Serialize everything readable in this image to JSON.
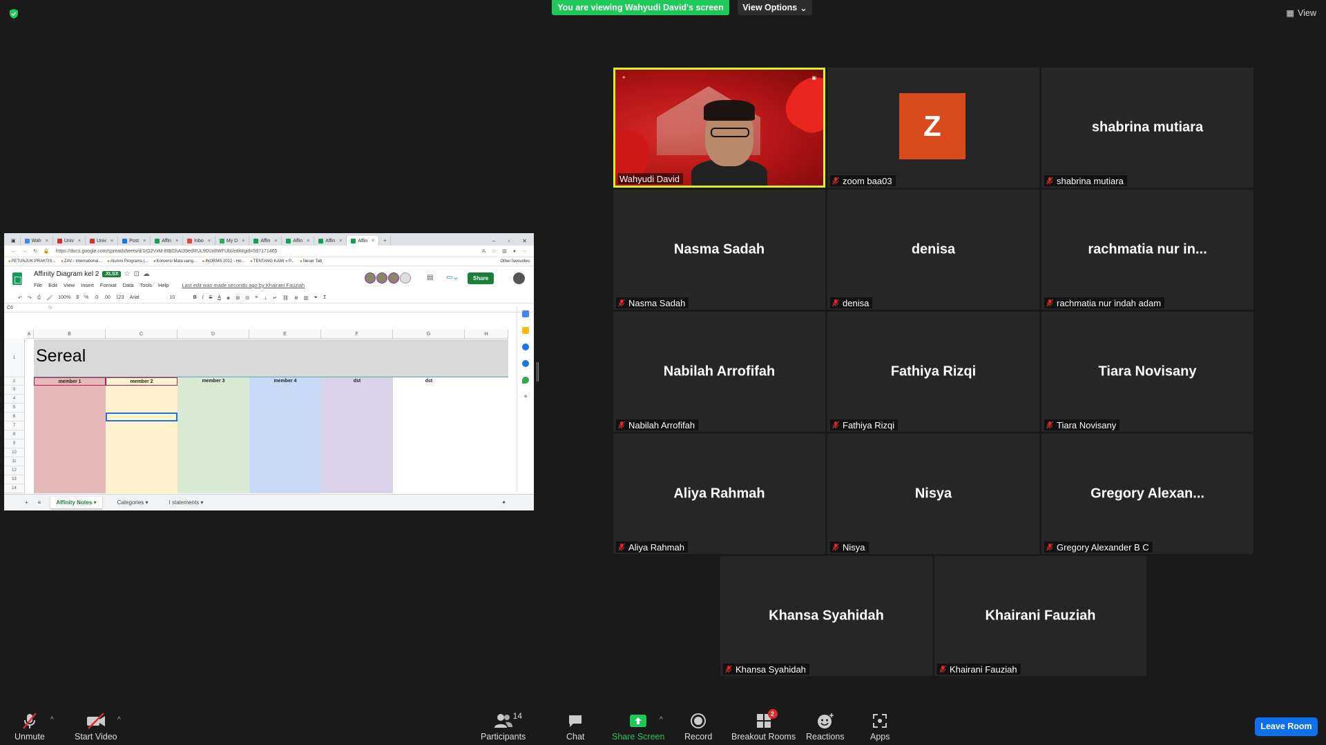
{
  "meeting": {
    "banner": "You are viewing Wahyudi David's screen",
    "view_options": "View Options",
    "view": "View"
  },
  "shared_screen": {
    "browser_tabs": [
      "Wah",
      "Univ",
      "Univ",
      "Post",
      "Affin",
      "Inbo",
      "My D",
      "Affin",
      "Affin",
      "Affin",
      "Affin"
    ],
    "url": "https://docs.google.com/spreadsheets/d/1IO2VxM-8IBGhAI39edRUL90Ux8WFUbI/edit#gid=597171465",
    "bookmarks": [
      "PETUNJUK PRAKTIS...",
      "ZAV - International...",
      "Alumni Programs |...",
      "Konversi Mata uang...",
      "INORMS 2012 - Ho...",
      "TENTANG KAMI » P...",
      "Neuer Tab"
    ],
    "other_favourites": "Other favourites",
    "doc_title": "Affinity Diagram kel 2",
    "doc_badge": ".XLSX",
    "menus": [
      "File",
      "Edit",
      "View",
      "Insert",
      "Format",
      "Data",
      "Tools",
      "Help"
    ],
    "last_edit": "Last edit was made seconds ago by Khairani Fauziah",
    "share_label": "Share",
    "toolbar": {
      "zoom": "100%",
      "currency": "$",
      "percent": "%",
      "dec_less": ".0",
      "dec_more": ".00",
      "format": "123",
      "font": "Arial",
      "size": "10",
      "bold": "B",
      "italic": "I",
      "strike": "S",
      "text_color": "A"
    },
    "cell_ref": "C6",
    "fx": "fx",
    "columns": [
      "A",
      "B",
      "C",
      "D",
      "E",
      "F",
      "G",
      "H"
    ],
    "rows": [
      "1",
      "2",
      "3",
      "4",
      "5",
      "6",
      "7",
      "8",
      "9",
      "10",
      "11",
      "12",
      "13",
      "14"
    ],
    "sheet_title": "Sereal",
    "column_heads": [
      "member 1",
      "member 2",
      "member 3",
      "member 4",
      "dst",
      "dst"
    ],
    "column_colors": [
      "#e6b8b7",
      "#fff2cc",
      "#d9ead3",
      "#c9daf8",
      "#d9d2e9",
      "#ffffff"
    ],
    "sheet_tabs": [
      "Affinity Notes",
      "Categories",
      "I statements"
    ]
  },
  "participants": [
    {
      "name": "Wahyudi David",
      "display": "",
      "video": true
    },
    {
      "name": "zoom baa03",
      "display": "",
      "avatar_letter": "Z"
    },
    {
      "name": "shabrina mutiara",
      "display": "shabrina mutiara"
    },
    {
      "name": "Nasma Sadah",
      "display": "Nasma Sadah"
    },
    {
      "name": "denisa",
      "display": "denisa"
    },
    {
      "name": "rachmatia nur indah adam",
      "display": "rachmatia nur in..."
    },
    {
      "name": "Nabilah Arrofifah",
      "display": "Nabilah Arrofifah"
    },
    {
      "name": "Fathiya Rizqi",
      "display": "Fathiya Rizqi"
    },
    {
      "name": "Tiara Novisany",
      "display": "Tiara Novisany"
    },
    {
      "name": "Aliya Rahmah",
      "display": "Aliya Rahmah"
    },
    {
      "name": "Nisya",
      "display": "Nisya"
    },
    {
      "name": "Gregory Alexander B C",
      "display": "Gregory  Alexan..."
    },
    {
      "name": "Khansa Syahidah",
      "display": "Khansa Syahidah"
    },
    {
      "name": "Khairani Fauziah",
      "display": "Khairani Fauziah"
    }
  ],
  "toolbar": {
    "unmute": "Unmute",
    "start_video": "Start Video",
    "participants": "Participants",
    "participant_count": "14",
    "chat": "Chat",
    "share_screen": "Share Screen",
    "record": "Record",
    "breakout_rooms": "Breakout Rooms",
    "breakout_badge": "2",
    "reactions": "Reactions",
    "apps": "Apps",
    "leave": "Leave Room"
  },
  "colors": {
    "green": "#1ec95a",
    "leave_blue": "#0e71eb",
    "speaker_border": "#d7ef2f",
    "avatar_z": "#d8491c"
  }
}
